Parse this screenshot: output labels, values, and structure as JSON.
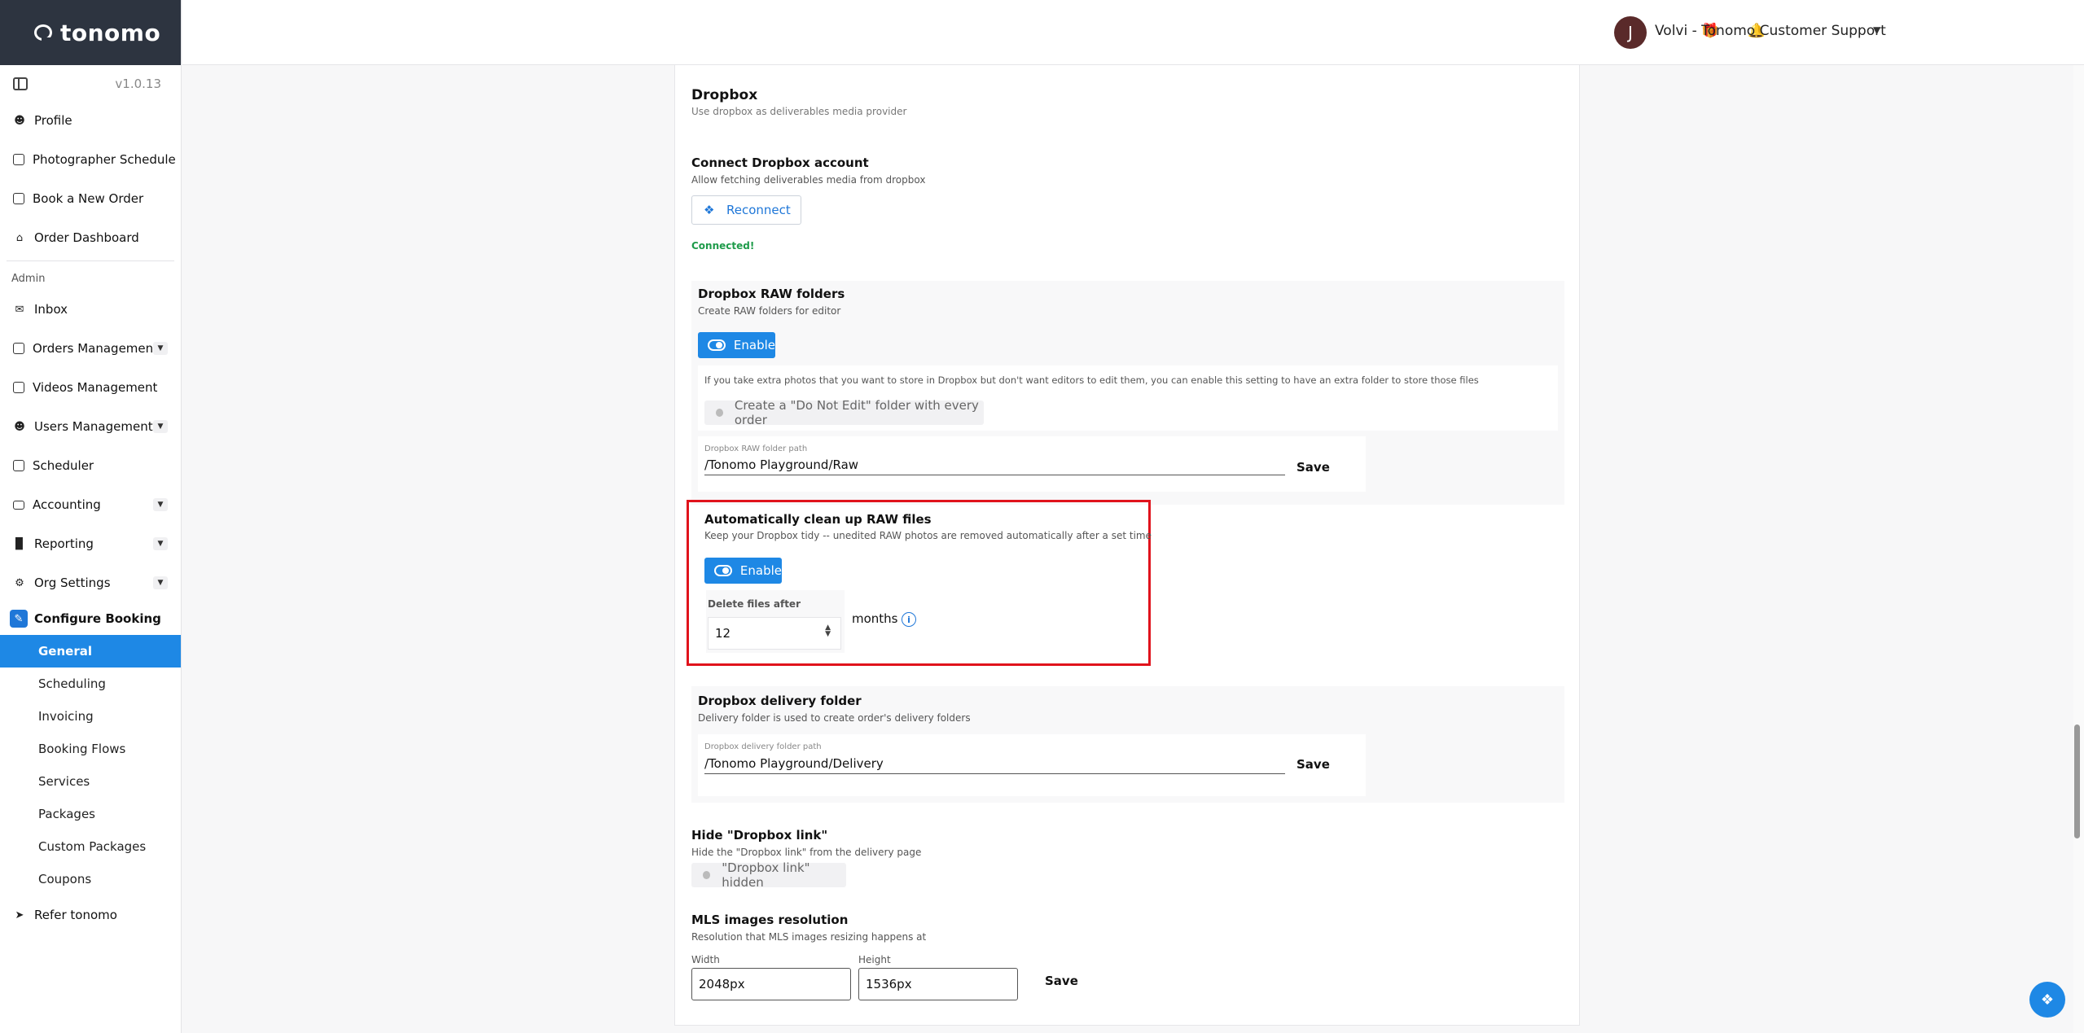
{
  "app": {
    "brand": "tonomo",
    "version": "v1.0.13"
  },
  "sidebar": {
    "items": [
      {
        "label": "Profile",
        "icon": "person-icon"
      },
      {
        "label": "Photographer Schedule",
        "icon": "calendar-check-icon"
      },
      {
        "label": "Book a New Order",
        "icon": "calendar-plus-icon"
      },
      {
        "label": "Order Dashboard",
        "icon": "home-icon"
      }
    ],
    "admin_label": "Admin",
    "admin_items": [
      {
        "label": "Inbox",
        "icon": "mail-icon",
        "expandable": false
      },
      {
        "label": "Orders Management",
        "icon": "clipboard-icon",
        "expandable": true
      },
      {
        "label": "Videos Management",
        "icon": "video-icon",
        "expandable": false
      },
      {
        "label": "Users Management",
        "icon": "users-icon",
        "expandable": true
      },
      {
        "label": "Scheduler",
        "icon": "calendar-icon",
        "expandable": false
      },
      {
        "label": "Accounting",
        "icon": "credit-card-icon",
        "expandable": true
      },
      {
        "label": "Reporting",
        "icon": "bar-chart-icon",
        "expandable": true
      },
      {
        "label": "Org Settings",
        "icon": "gear-icon",
        "expandable": true
      }
    ],
    "configure_booking": "Configure Booking",
    "sub_items": [
      "General",
      "Scheduling",
      "Invoicing",
      "Booking Flows",
      "Services",
      "Packages",
      "Custom Packages",
      "Coupons"
    ],
    "active_sub": "General",
    "refer": "Refer tonomo"
  },
  "topbar": {
    "user_initial": "J",
    "user_name": "Volvi - Tonomo Customer Support"
  },
  "dropbox": {
    "title": "Dropbox",
    "subtitle": "Use dropbox as deliverables media provider",
    "connect": {
      "title": "Connect Dropbox account",
      "desc": "Allow fetching deliverables media from dropbox",
      "button": "Reconnect",
      "status": "Connected!"
    },
    "raw": {
      "title": "Dropbox RAW folders",
      "desc": "Create RAW folders for editor",
      "toggle": "Enable",
      "extra_note": "If you take extra photos that you want to store in Dropbox but don't want editors to edit them, you can enable this setting to have an extra folder to store those files",
      "do_not_edit": "Create a \"Do Not Edit\" folder with every order",
      "path_label": "Dropbox RAW folder path",
      "path_value": "/Tonomo Playground/Raw",
      "save": "Save"
    },
    "cleanup": {
      "title": "Automatically clean up RAW files",
      "desc": "Keep your Dropbox tidy -- unedited RAW photos are removed automatically after a set time",
      "toggle": "Enable",
      "delete_label": "Delete files after",
      "months_value": "12",
      "unit": "months"
    },
    "delivery": {
      "title": "Dropbox delivery folder",
      "desc": "Delivery folder is used to create order's delivery folders",
      "path_label": "Dropbox delivery folder path",
      "path_value": "/Tonomo Playground/Delivery",
      "save": "Save"
    },
    "hide_link": {
      "title": "Hide \"Dropbox link\"",
      "desc": "Hide the \"Dropbox link\" from the delivery page",
      "toggle": "\"Dropbox link\" hidden"
    },
    "mls": {
      "title": "MLS images resolution",
      "desc": "Resolution that MLS images resizing happens at",
      "width_label": "Width",
      "width_value": "2048px",
      "height_label": "Height",
      "height_value": "1536px",
      "save": "Save"
    }
  },
  "colors": {
    "accent": "#1e88e5",
    "brand_bg": "#2d3440",
    "success": "#1e9b4a",
    "highlight": "#e0131c"
  }
}
